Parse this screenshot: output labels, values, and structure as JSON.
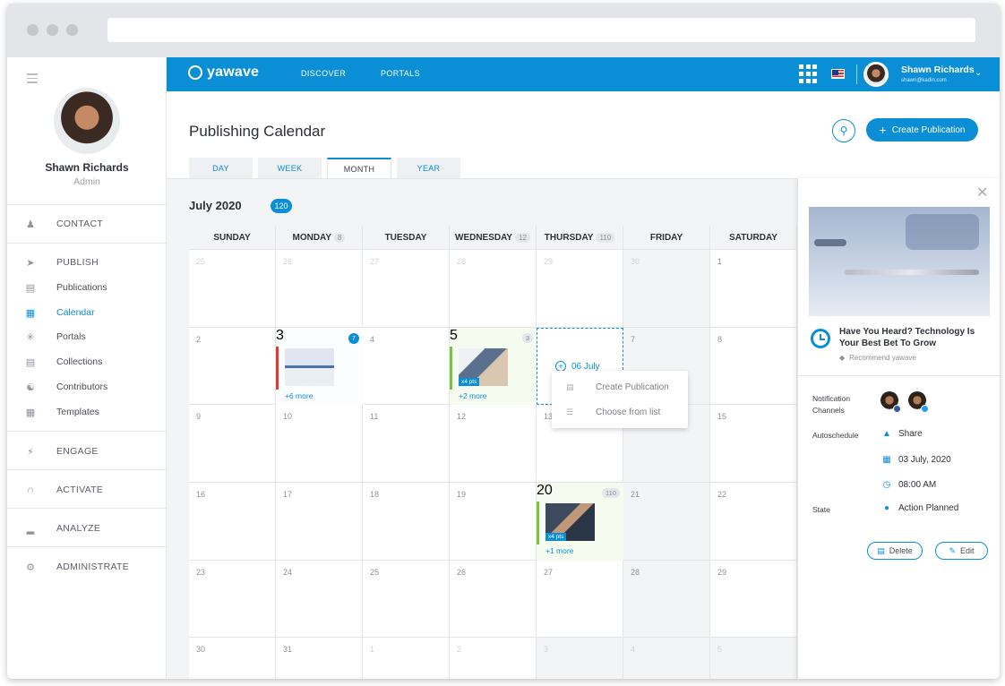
{
  "sidebar": {
    "user_name": "Shawn Richards",
    "user_role": "Admin",
    "items": [
      {
        "label": "CONTACT",
        "icon": "contact-icon"
      },
      {
        "label": "PUBLISH",
        "icon": "publish-icon"
      },
      {
        "label": "Publications",
        "icon": "publications-icon"
      },
      {
        "label": "Calendar",
        "icon": "calendar-icon",
        "active": true
      },
      {
        "label": "Portals",
        "icon": "portals-icon"
      },
      {
        "label": "Collections",
        "icon": "collections-icon"
      },
      {
        "label": "Contributors",
        "icon": "contributors-icon"
      },
      {
        "label": "Templates",
        "icon": "templates-icon"
      },
      {
        "label": "ENGAGE",
        "icon": "engage-icon"
      },
      {
        "label": "ACTIVATE",
        "icon": "activate-icon"
      },
      {
        "label": "ANALYZE",
        "icon": "analyze-icon"
      },
      {
        "label": "ADMINISTRATE",
        "icon": "administrate-icon"
      }
    ]
  },
  "topbar": {
    "brand": "yawave",
    "nav": [
      "DISCOVER",
      "PORTALS"
    ],
    "user_name": "Shawn Richards",
    "user_email": "shawn@kadin.com"
  },
  "page": {
    "title": "Publishing Calendar",
    "create_label": "Create Publication",
    "tabs": [
      "DAY",
      "WEEK",
      "MONTH",
      "YEAR"
    ],
    "active_tab": "MONTH",
    "month_label": "July 2020",
    "month_count": "120"
  },
  "calendar": {
    "headers": [
      {
        "day": "SUNDAY",
        "count": ""
      },
      {
        "day": "MONDAY",
        "count": "8"
      },
      {
        "day": "TUESDAY",
        "count": ""
      },
      {
        "day": "WEDNESDAY",
        "count": "12"
      },
      {
        "day": "THURSDAY",
        "count": "110"
      },
      {
        "day": "FRIDAY",
        "count": ""
      },
      {
        "day": "SATURDAY",
        "count": ""
      }
    ],
    "weeks": [
      [
        "25",
        "26",
        "27",
        "28",
        "29",
        "30",
        "1"
      ],
      [
        "2",
        "3",
        "4",
        "5",
        "",
        "7",
        "8"
      ],
      [
        "9",
        "10",
        "11",
        "12",
        "13",
        "14",
        "15"
      ],
      [
        "16",
        "17",
        "18",
        "19",
        "20",
        "21",
        "22"
      ],
      [
        "23",
        "24",
        "25",
        "26",
        "27",
        "28",
        "29"
      ],
      [
        "30",
        "31",
        "1",
        "2",
        "3",
        "4",
        "5"
      ]
    ],
    "events": {
      "monday_3": {
        "badge": "7",
        "more": "+6 more"
      },
      "wednesday_5": {
        "badge": "3",
        "tag": "x4 pts",
        "more": "+2 more"
      },
      "thursday_20": {
        "badge": "110",
        "tag": "x4 pts",
        "more": "+1 more"
      }
    },
    "selected_date": "06 July",
    "context_menu": [
      "Create Publication",
      "Choose from list"
    ],
    "colors": {
      "accent": "#0a8fd6",
      "red": "#e53935",
      "green": "#7cc243"
    }
  },
  "panel": {
    "title": "Have You Heard? Technology Is Your Best Bet To Grow",
    "subtitle": "Recommend yawave",
    "notification_label": "Notification Channels",
    "autoschedule_label": "Autoschedule",
    "share_label": "Share",
    "date": "03 July, 2020",
    "time": "08:00 AM",
    "state_label": "State",
    "state_value": "Action Planned",
    "delete_label": "Delete",
    "edit_label": "Edit"
  }
}
